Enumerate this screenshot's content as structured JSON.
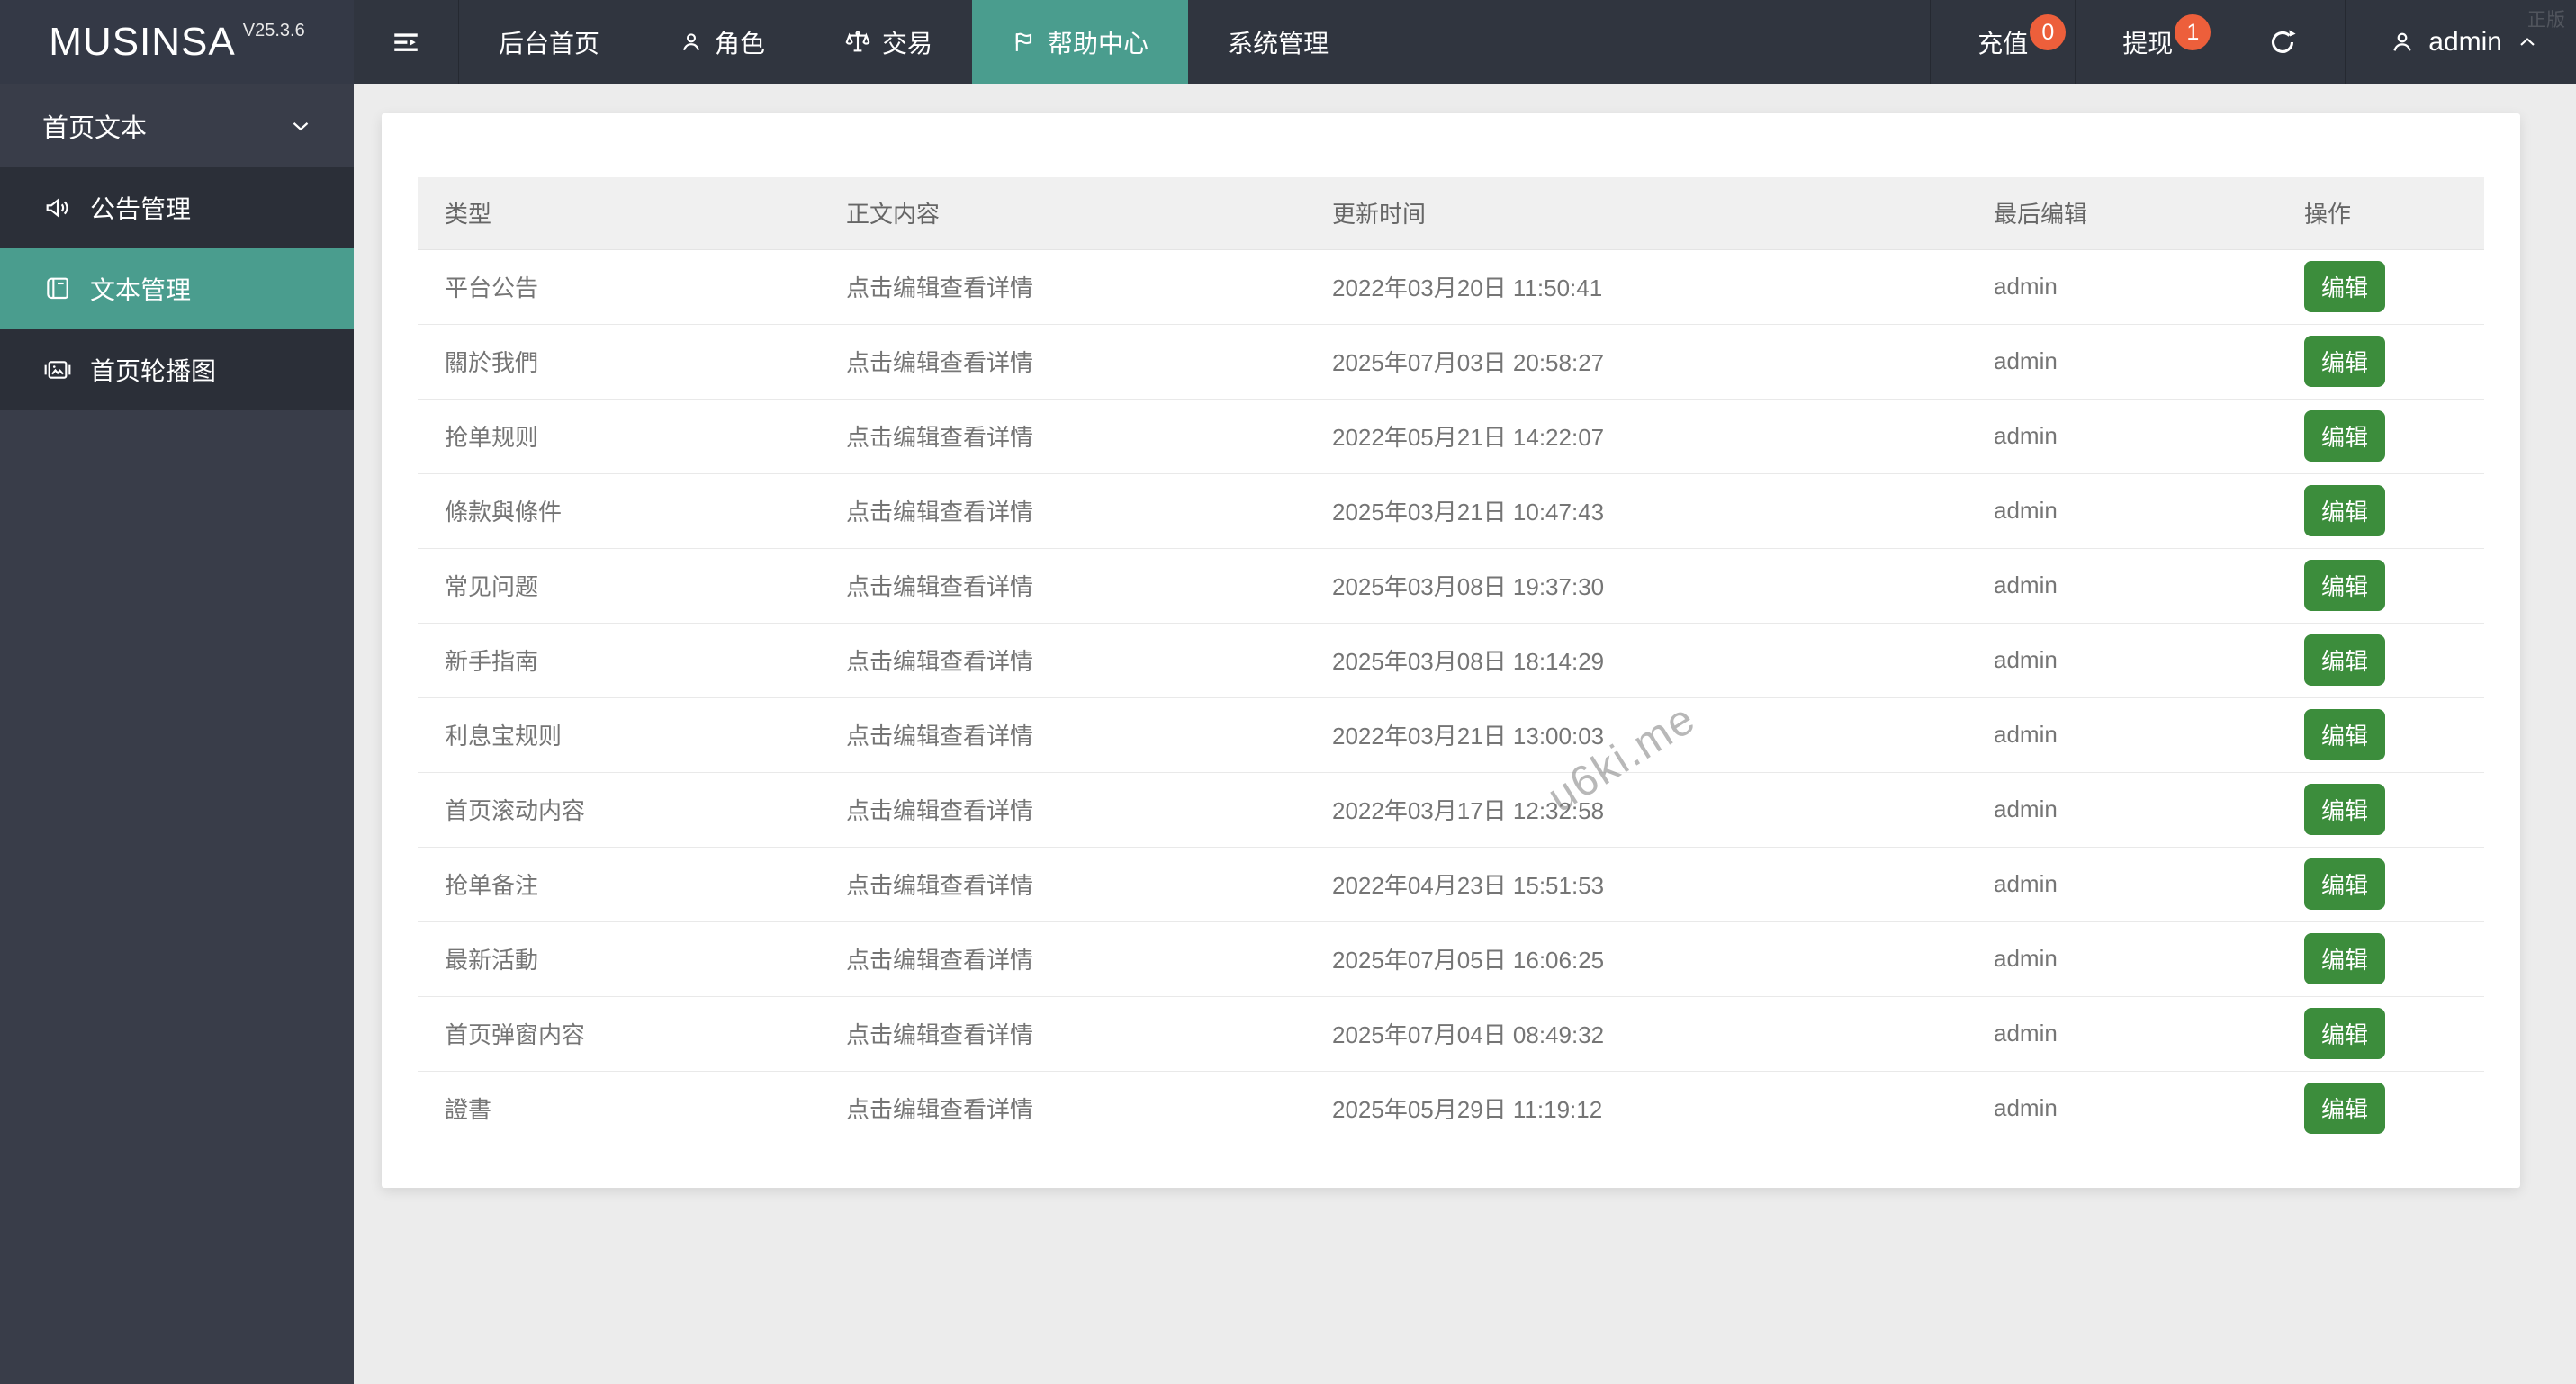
{
  "navbar": {
    "logo": "MUSINSA",
    "version": "V25.3.6",
    "hamburger_icon": "menu-collapse-icon",
    "menu": [
      {
        "label": "后台首页"
      },
      {
        "label": "角色",
        "icon": "person-icon"
      },
      {
        "label": "交易",
        "icon": "scales-icon"
      },
      {
        "label": "帮助中心",
        "icon": "flag-icon",
        "active": true
      },
      {
        "label": "系统管理"
      }
    ],
    "quick_actions": [
      {
        "label": "充值",
        "badge": "0"
      },
      {
        "label": "提现",
        "badge": "1"
      }
    ],
    "refresh_icon": "refresh-icon",
    "user": {
      "icon": "person-icon",
      "name": "admin",
      "chevron": "chevron-up-icon"
    },
    "corner_watermark": "正版"
  },
  "sidebar": {
    "group": {
      "label": "首页文本",
      "chevron": "chevron-down-icon"
    },
    "items": [
      {
        "label": "公告管理",
        "icon": "speaker-icon"
      },
      {
        "label": "文本管理",
        "icon": "book-icon",
        "active": true
      },
      {
        "label": "首页轮播图",
        "icon": "carousel-icon"
      }
    ]
  },
  "table": {
    "headers": [
      "类型",
      "正文内容",
      "更新时间",
      "最后编辑",
      "操作"
    ],
    "edit_label": "编辑",
    "rows": [
      {
        "type": "平台公告",
        "content": "点击编辑查看详情",
        "time": "2022年03月20日 11:50:41",
        "editor": "admin"
      },
      {
        "type": "關於我們",
        "content": "点击编辑查看详情",
        "time": "2025年07月03日 20:58:27",
        "editor": "admin"
      },
      {
        "type": "抢单规则",
        "content": "点击编辑查看详情",
        "time": "2022年05月21日 14:22:07",
        "editor": "admin"
      },
      {
        "type": "條款與條件",
        "content": "点击编辑查看详情",
        "time": "2025年03月21日 10:47:43",
        "editor": "admin"
      },
      {
        "type": "常见问题",
        "content": "点击编辑查看详情",
        "time": "2025年03月08日 19:37:30",
        "editor": "admin"
      },
      {
        "type": "新手指南",
        "content": "点击编辑查看详情",
        "time": "2025年03月08日 18:14:29",
        "editor": "admin"
      },
      {
        "type": "利息宝规则",
        "content": "点击编辑查看详情",
        "time": "2022年03月21日 13:00:03",
        "editor": "admin"
      },
      {
        "type": "首页滚动内容",
        "content": "点击编辑查看详情",
        "time": "2022年03月17日 12:32:58",
        "editor": "admin"
      },
      {
        "type": "抢单备注",
        "content": "点击编辑查看详情",
        "time": "2022年04月23日 15:51:53",
        "editor": "admin"
      },
      {
        "type": "最新活動",
        "content": "点击编辑查看详情",
        "time": "2025年07月05日 16:06:25",
        "editor": "admin"
      },
      {
        "type": "首页弹窗内容",
        "content": "点击编辑查看详情",
        "time": "2025年07月04日 08:49:32",
        "editor": "admin"
      },
      {
        "type": "證書",
        "content": "点击编辑查看详情",
        "time": "2025年05月29日 11:19:12",
        "editor": "admin"
      }
    ]
  },
  "watermark": "u6ki.me",
  "colors": {
    "header_bg": "#30353F",
    "sidebar_bg": "#393D49",
    "sidebar_item_bg": "#2B2F38",
    "accent_teal": "#4A9D8E",
    "edit_green": "#3C8D3C",
    "badge_orange": "#ED5F3B",
    "content_bg": "#ECECEC"
  }
}
